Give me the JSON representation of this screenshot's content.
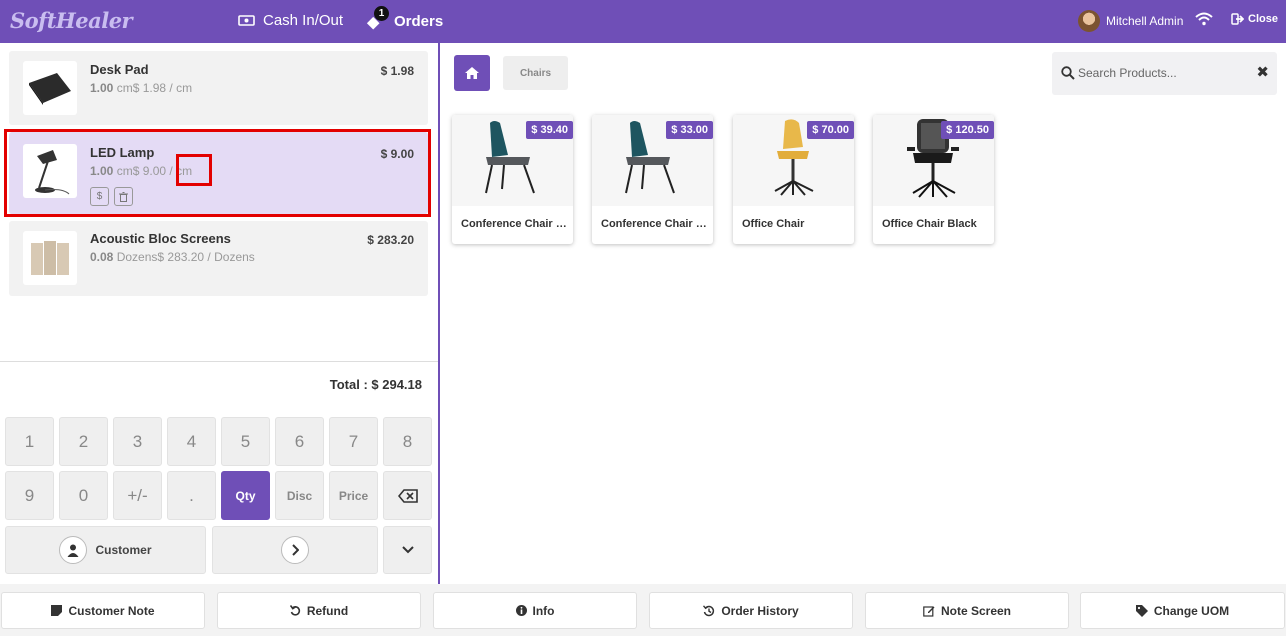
{
  "app": {
    "logo_text": "SoftHealer",
    "cash_label": "Cash In/Out",
    "orders_label": "Orders",
    "orders_count": "1",
    "user_name": "Mitchell Admin",
    "close_label": "Close",
    "accent_color": "#6f4fb7"
  },
  "order": {
    "lines": [
      {
        "name": "Desk Pad",
        "price": "$ 1.98",
        "qty": "1.00",
        "detail": "cm$ 1.98 / cm",
        "icon": "desk-pad-image"
      },
      {
        "name": "LED Lamp",
        "price": "$ 9.00",
        "qty": "1.00",
        "detail": "cm$ 9.00 / cm",
        "icon": "led-lamp-image",
        "selected": true
      },
      {
        "name": "Acoustic Bloc Screens",
        "price": "$ 283.20",
        "qty": "0.08",
        "detail": "Dozens$ 283.20 / Dozens",
        "icon": "acoustic-screens-image"
      }
    ],
    "line_buttons": {
      "price_icon": "$"
    },
    "total": "Total : $ 294.18"
  },
  "numpad": {
    "row1": [
      "1",
      "2",
      "3",
      "4",
      "5",
      "6",
      "7",
      "8"
    ],
    "row2": [
      "9",
      "0",
      "+/-",
      ".",
      "Qty",
      "Disc",
      "Price"
    ],
    "customer_label": "Customer"
  },
  "products": {
    "category": "Chairs",
    "search_placeholder": "Search Products...",
    "items": [
      {
        "name": "Conference Chair (Steel)",
        "price": "$ 39.40"
      },
      {
        "name": "Conference Chair (Aluminium)",
        "price": "$ 33.00"
      },
      {
        "name": "Office Chair",
        "price": "$ 70.00"
      },
      {
        "name": "Office Chair Black",
        "price": "$ 120.50"
      }
    ]
  },
  "actions": {
    "customer_note": "Customer Note",
    "refund": "Refund",
    "info": "Info",
    "order_history": "Order History",
    "note_screen": "Note Screen",
    "change_uom": "Change UOM"
  }
}
